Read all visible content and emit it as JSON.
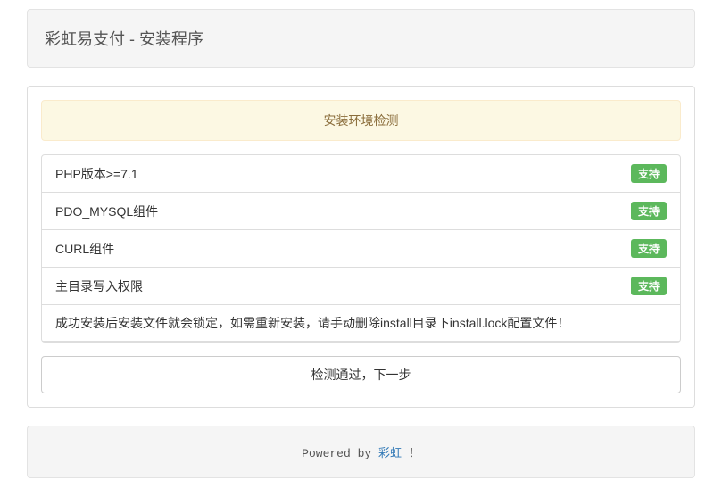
{
  "header": {
    "title": "彩虹易支付 - 安装程序"
  },
  "alert": {
    "text": "安装环境检测"
  },
  "checks": [
    {
      "label": "PHP版本>=7.1",
      "status": "支持"
    },
    {
      "label": "PDO_MYSQL组件",
      "status": "支持"
    },
    {
      "label": "CURL组件",
      "status": "支持"
    },
    {
      "label": "主目录写入权限",
      "status": "支持"
    }
  ],
  "notice": "成功安装后安装文件就会锁定，如需重新安装，请手动删除install目录下install.lock配置文件！",
  "button": {
    "label": "检测通过，下一步"
  },
  "footer": {
    "prefix": "Powered by ",
    "link_text": "彩虹",
    "suffix": " ！"
  }
}
